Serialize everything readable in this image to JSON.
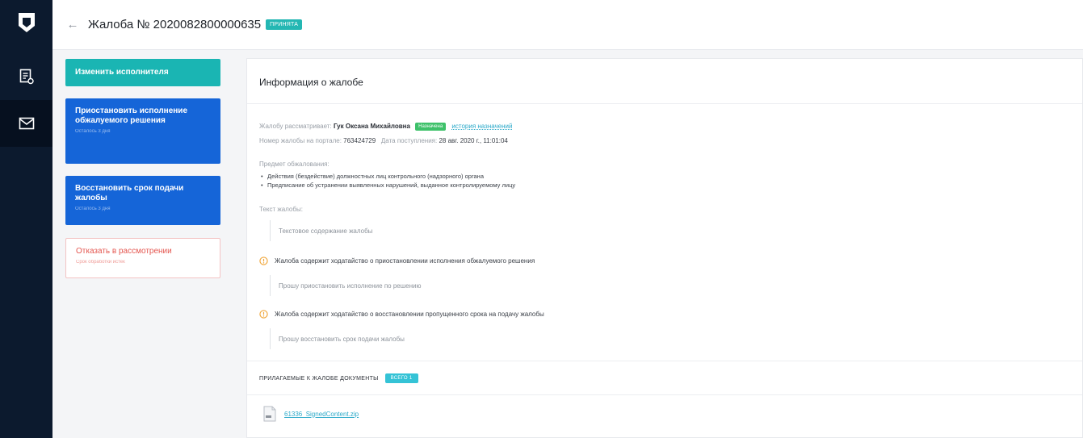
{
  "header": {
    "title": "Жалоба № 2020082800000635",
    "status_badge": "ПРИНЯТА"
  },
  "actions": {
    "change_executor": {
      "label": "Изменить исполнителя"
    },
    "suspend_execution": {
      "label": "Приостановить исполнение обжалуемого решения",
      "sub": "Осталось 3 дня"
    },
    "restore_deadline": {
      "label": "Восстановить срок подачи жалобы",
      "sub": "Осталось 3 дня"
    },
    "reject": {
      "label": "Отказать в рассмотрении",
      "sub": "Срок обработки истек"
    }
  },
  "card": {
    "title": "Информация о жалобе",
    "reviewer_label": "Жалобу рассматривает:",
    "reviewer_name": "Гук Оксана Михайловна",
    "reviewer_tag": "Назначена",
    "history_link": "история назначений",
    "portal_number_label": "Номер жалобы на портале:",
    "portal_number": "763424729",
    "received_label": "Дата поступления:",
    "received_date": "28 авг. 2020 г., 11:01:04",
    "subject_label": "Предмет обжалования:",
    "subjects": [
      "Действия (бездействие) должностных лиц контрольного (надзорного) органа",
      "Предписание об устранении выявленных нарушений, выданное контролируемому лицу"
    ],
    "text_label": "Текст жалобы:",
    "text_content": "Текстовое содержание жалобы",
    "petition1": "Жалоба содержит ходатайство о приостановлении исполнения обжалуемого решения",
    "petition1_text": "Прошу приостановить исполнение по решению",
    "petition2": "Жалоба содержит ходатайство о восстановлении пропущенного срока на подачу жалобы",
    "petition2_text": "Прошу восстановить срок подачи жалобы",
    "docs_title": "ПРИЛАГАЕМЫЕ К ЖАЛОБЕ ДОКУМЕНТЫ",
    "docs_count": "ВСЕГО 1",
    "file_name": "61336_SignedContent.zip"
  },
  "colors": {
    "rail": "#0c1a2e",
    "teal": "#1ab5b3",
    "blue": "#1565d8",
    "danger": "#e4564f",
    "warning": "#f0a63a",
    "link": "#2aa9c9"
  }
}
